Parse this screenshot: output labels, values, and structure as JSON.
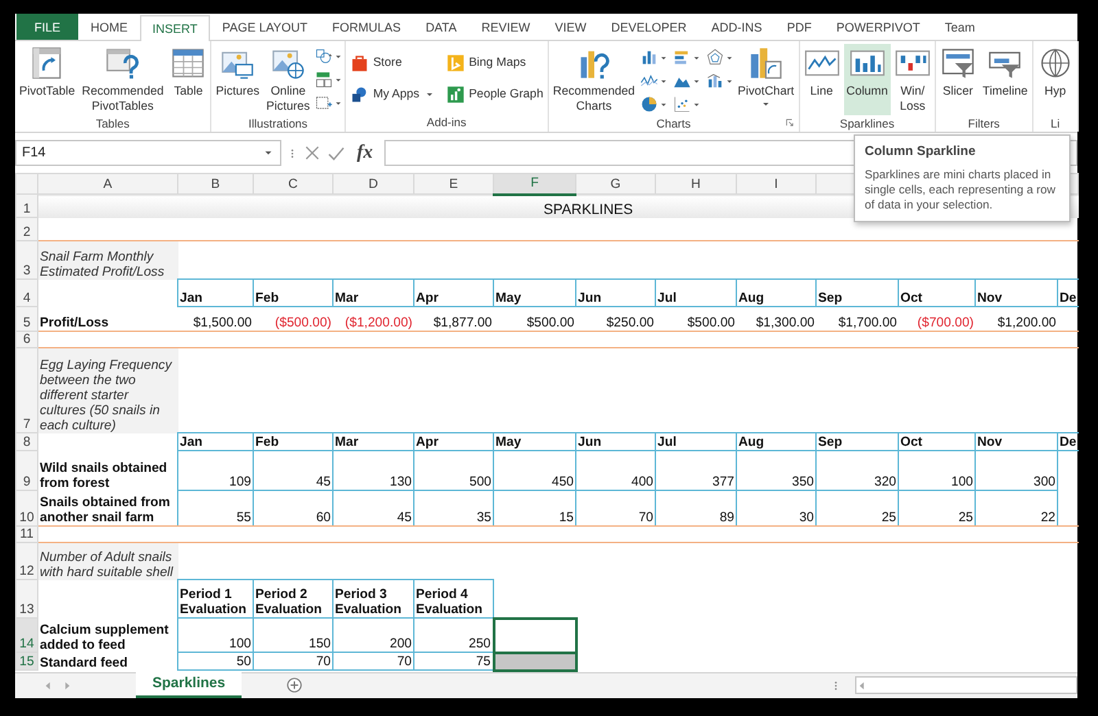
{
  "ribbon_tabs": [
    {
      "label": "FILE",
      "kind": "file",
      "selected": false
    },
    {
      "label": "HOME",
      "kind": "tab",
      "selected": false
    },
    {
      "label": "INSERT",
      "kind": "tab",
      "selected": true
    },
    {
      "label": "PAGE LAYOUT",
      "kind": "tab",
      "selected": false
    },
    {
      "label": "FORMULAS",
      "kind": "tab",
      "selected": false
    },
    {
      "label": "DATA",
      "kind": "tab",
      "selected": false
    },
    {
      "label": "REVIEW",
      "kind": "tab",
      "selected": false
    },
    {
      "label": "VIEW",
      "kind": "tab",
      "selected": false
    },
    {
      "label": "DEVELOPER",
      "kind": "tab",
      "selected": false
    },
    {
      "label": "ADD-INS",
      "kind": "tab",
      "selected": false
    },
    {
      "label": "PDF",
      "kind": "tab",
      "selected": false
    },
    {
      "label": "POWERPIVOT",
      "kind": "tab",
      "selected": false
    },
    {
      "label": "Team",
      "kind": "tab",
      "selected": false
    }
  ],
  "ribbon_groups": [
    {
      "label": "Tables",
      "commands": [
        {
          "label": "PivotTable",
          "kind": "large"
        },
        {
          "label": "Recommended PivotTables",
          "kind": "large"
        },
        {
          "label": "Table",
          "kind": "large"
        }
      ]
    },
    {
      "label": "Illustrations",
      "commands": [
        {
          "label": "Pictures",
          "kind": "large"
        },
        {
          "label": "Online Pictures",
          "kind": "large"
        }
      ]
    },
    {
      "label": "Add-ins",
      "commands": [
        {
          "label": "Store",
          "kind": "small"
        },
        {
          "label": "Bing Maps",
          "kind": "small"
        },
        {
          "label": "My Apps",
          "kind": "small",
          "dropdown": true
        },
        {
          "label": "People Graph",
          "kind": "small"
        }
      ]
    },
    {
      "label": "Charts",
      "commands": [
        {
          "label": "Recommended Charts",
          "kind": "large"
        },
        {
          "label": "PivotChart",
          "kind": "large",
          "dropdown": true
        }
      ]
    },
    {
      "label": "Sparklines",
      "commands": [
        {
          "label": "Line",
          "kind": "large",
          "highlighted": false
        },
        {
          "label": "Column",
          "kind": "large",
          "highlighted": true
        },
        {
          "label": "Win/ Loss",
          "kind": "large",
          "highlighted": false
        }
      ]
    },
    {
      "label": "Filters",
      "commands": [
        {
          "label": "Slicer",
          "kind": "large"
        },
        {
          "label": "Timeline",
          "kind": "large"
        }
      ]
    },
    {
      "label": "Li",
      "commands": [
        {
          "label": "Hyp",
          "kind": "large"
        }
      ]
    }
  ],
  "tooltip": {
    "title": "Column Sparkline",
    "text": "Sparklines are mini charts placed in single cells, each representing a row of data in your selection."
  },
  "formula_bar": {
    "name_box": "F14",
    "function_label": "fx"
  },
  "sheet": {
    "columns": [
      {
        "label": "A",
        "selected": false
      },
      {
        "label": "B",
        "selected": false
      },
      {
        "label": "C",
        "selected": false
      },
      {
        "label": "D",
        "selected": false
      },
      {
        "label": "E",
        "selected": false
      },
      {
        "label": "F",
        "selected": true
      },
      {
        "label": "G",
        "selected": false
      },
      {
        "label": "H",
        "selected": false
      },
      {
        "label": "I",
        "selected": false
      }
    ],
    "rows": [
      {
        "number": "1",
        "kind": "title",
        "selected": false,
        "title": "SPARKLINES"
      },
      {
        "number": "2",
        "kind": "blank",
        "selected": false
      },
      {
        "number": "3",
        "kind": "note",
        "selected": false,
        "label": "Snail Farm Monthly Estimated Profit/Loss"
      },
      {
        "number": "4",
        "kind": "header",
        "selected": false,
        "values": [
          "Jan",
          "Feb",
          "Mar",
          "Apr",
          "May",
          "Jun",
          "Jul",
          "Aug",
          "Sep",
          "Oct",
          "Nov",
          "De"
        ]
      },
      {
        "number": "5",
        "kind": "currency",
        "selected": false,
        "label": "Profit/Loss",
        "values": [
          {
            "text": "$1,500.00",
            "negative": false
          },
          {
            "text": "($500.00)",
            "negative": true
          },
          {
            "text": "($1,200.00)",
            "negative": true
          },
          {
            "text": "$1,877.00",
            "negative": false
          },
          {
            "text": "$500.00",
            "negative": false
          },
          {
            "text": "$250.00",
            "negative": false
          },
          {
            "text": "$500.00",
            "negative": false
          },
          {
            "text": "$1,300.00",
            "negative": false
          },
          {
            "text": "$1,700.00",
            "negative": false
          },
          {
            "text": "($700.00)",
            "negative": true
          },
          {
            "text": "$1,200.00",
            "negative": false
          }
        ]
      },
      {
        "number": "6",
        "kind": "blank",
        "selected": false
      },
      {
        "number": "7",
        "kind": "note",
        "selected": false,
        "label": "Egg Laying Frequency between the two different starter cultures (50 snails in each culture)"
      },
      {
        "number": "8",
        "kind": "header",
        "selected": false,
        "values": [
          "Jan",
          "Feb",
          "Mar",
          "Apr",
          "May",
          "Jun",
          "Jul",
          "Aug",
          "Sep",
          "Oct",
          "Nov",
          "De"
        ]
      },
      {
        "number": "9",
        "kind": "data",
        "selected": false,
        "label": "Wild snails obtained from forest",
        "values": [
          "109",
          "45",
          "130",
          "500",
          "450",
          "400",
          "377",
          "350",
          "320",
          "100",
          "300"
        ]
      },
      {
        "number": "10",
        "kind": "data",
        "selected": false,
        "label": "Snails obtained from another snail farm",
        "values": [
          "55",
          "60",
          "45",
          "35",
          "15",
          "70",
          "89",
          "30",
          "25",
          "25",
          "22"
        ]
      },
      {
        "number": "11",
        "kind": "blank",
        "selected": false
      },
      {
        "number": "12",
        "kind": "note",
        "selected": false,
        "label": "Number of Adult snails with hard suitable shell"
      },
      {
        "number": "13",
        "kind": "header",
        "selected": false,
        "values": [
          "Period 1 Evaluation",
          "Period 2 Evaluation",
          "Period 3 Evaluation",
          "Period 4 Evaluation"
        ]
      },
      {
        "number": "14",
        "kind": "data",
        "selected": true,
        "label": "Calcium supplement added to feed",
        "values": [
          "100",
          "150",
          "200",
          "250"
        ]
      },
      {
        "number": "15",
        "kind": "data",
        "selected": true,
        "label": "Standard feed",
        "values": [
          "50",
          "70",
          "70",
          "75"
        ]
      }
    ]
  },
  "sheet_tabs": [
    {
      "label": "Sparklines",
      "selected": true
    }
  ]
}
